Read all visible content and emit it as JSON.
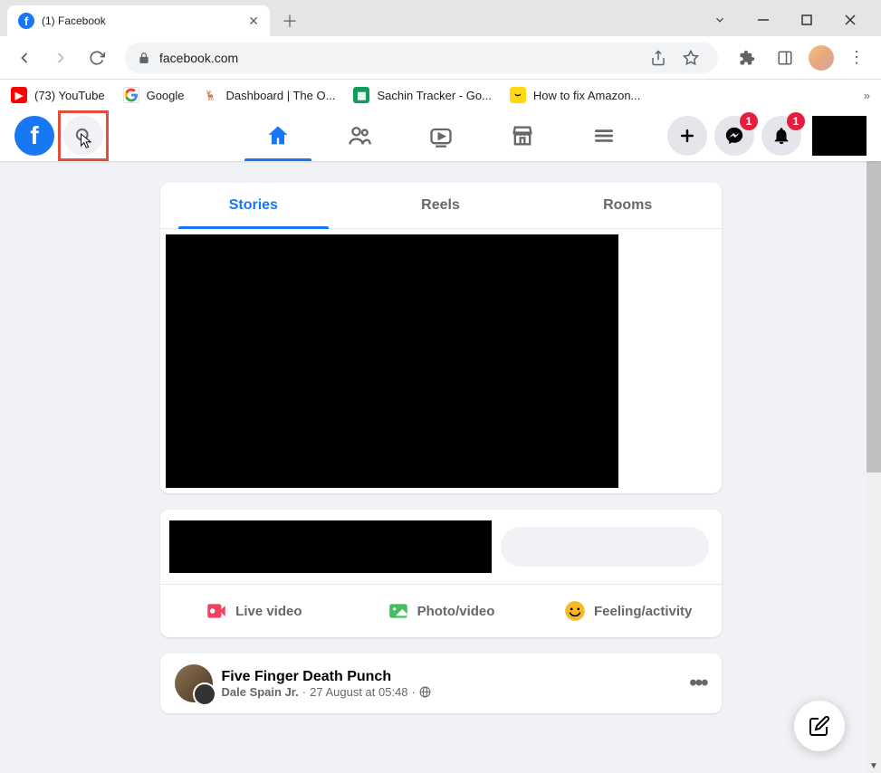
{
  "browser": {
    "tab_title": "(1) Facebook",
    "url": "facebook.com",
    "bookmarks": [
      {
        "label": "(73) YouTube"
      },
      {
        "label": "Google"
      },
      {
        "label": "Dashboard | The O..."
      },
      {
        "label": "Sachin Tracker - Go..."
      },
      {
        "label": "How to fix Amazon..."
      }
    ]
  },
  "fb": {
    "badges": {
      "messenger": "1",
      "notifications": "1"
    },
    "stories_tabs": [
      "Stories",
      "Reels",
      "Rooms"
    ],
    "composer": {
      "live": "Live video",
      "photo": "Photo/video",
      "feeling": "Feeling/activity"
    },
    "post": {
      "title": "Five Finger Death Punch",
      "author": "Dale Spain Jr.",
      "time": "27 August at 05:48"
    }
  }
}
